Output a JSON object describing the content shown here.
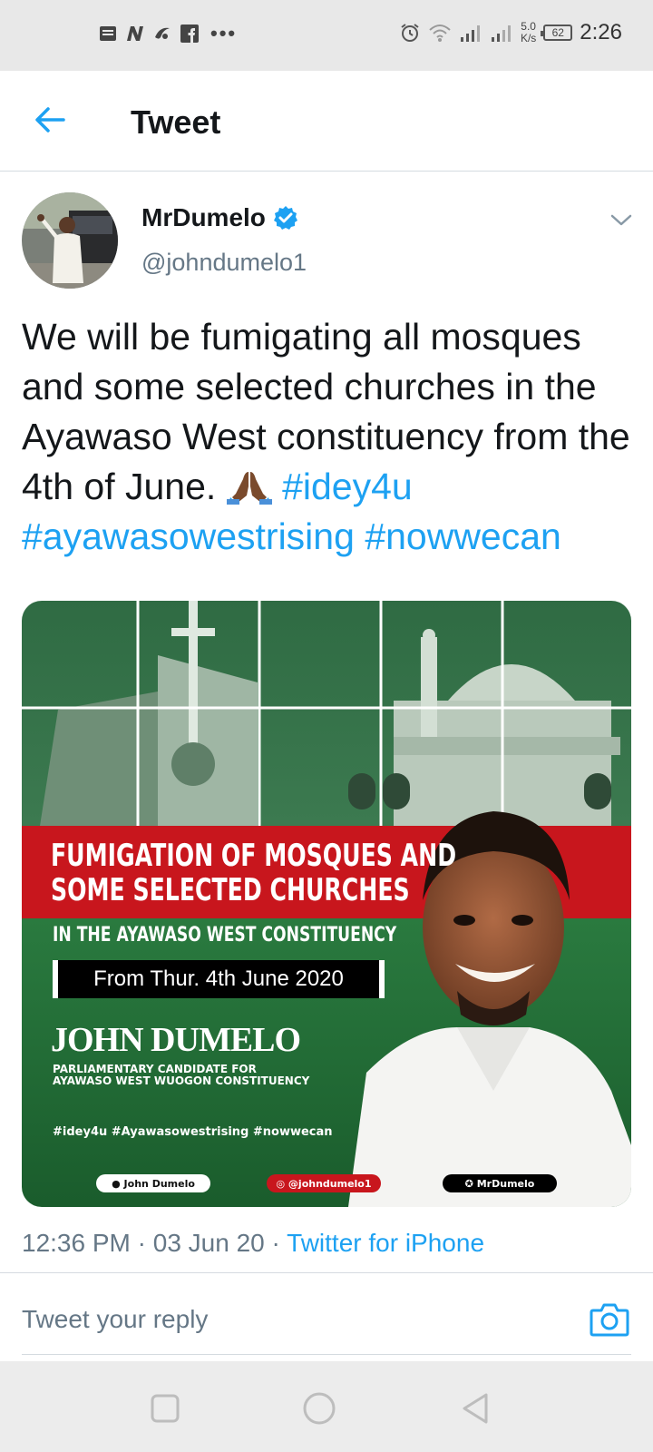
{
  "status_bar": {
    "network_speed_value": "5.0",
    "network_speed_unit": "K/s",
    "battery": "62",
    "time": "2:26"
  },
  "header": {
    "title": "Tweet"
  },
  "tweet": {
    "author_name": "MrDumelo",
    "author_handle": "@johndumelo1",
    "text": "We will be fumigating all mosques and some selected churches in the Ayawaso West constituency from the 4th of June.",
    "emoji": "🙏🏾",
    "hashtags": [
      "#idey4u",
      "#ayawasowestrising",
      "#nowwecan"
    ],
    "time": "12:36 PM",
    "date": "03 Jun 20",
    "source": "Twitter for iPhone",
    "separator": "·"
  },
  "media": {
    "headline_line1": "FUMIGATION OF MOSQUES AND",
    "headline_line2": "SOME SELECTED CHURCHES",
    "subheadline": "IN THE AYAWASO WEST CONSTITUENCY",
    "date_banner": "From Thur. 4th June 2020",
    "candidate_name": "JOHN DUMELO",
    "candidate_role_line1": "PARLIAMENTARY CANDIDATE FOR",
    "candidate_role_line2": "AYAWASO WEST WUOGON CONSTITUENCY",
    "hashtags_line": "#idey4u #Ayawasowestrising #nowwecan",
    "social_facebook": "John Dumelo",
    "social_instagram": "@johndumelo1",
    "social_twitter": "MrDumelo"
  },
  "reply": {
    "placeholder": "Tweet your reply"
  },
  "colors": {
    "accent": "#1da1f2",
    "text": "#14171a",
    "secondary": "#657786",
    "poster_red": "#c8161d",
    "poster_green": "#1f6b3a"
  }
}
